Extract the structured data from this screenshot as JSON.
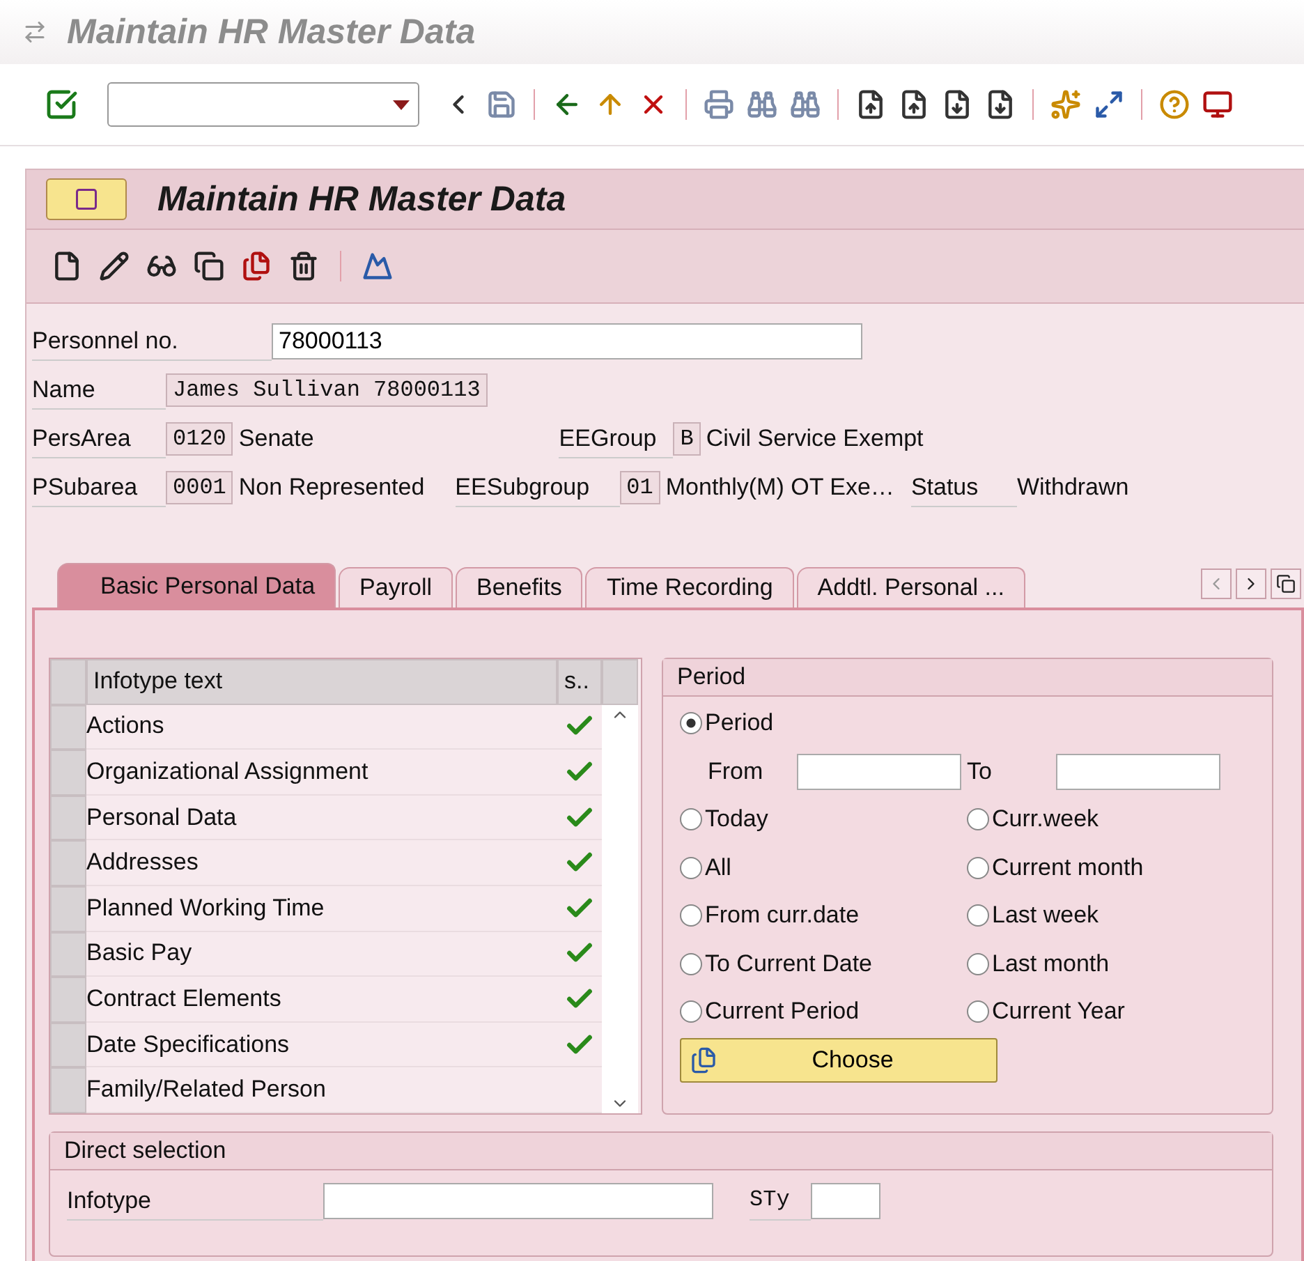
{
  "window": {
    "title": "Maintain HR Master Data"
  },
  "screen_title": "Maintain HR Master Data",
  "personnel_no": {
    "label": "Personnel no.",
    "value": "78000113"
  },
  "name": {
    "label": "Name",
    "value": "James Sullivan 78000113"
  },
  "pers_area": {
    "label": "PersArea",
    "code": "0120",
    "text": "Senate"
  },
  "ee_group": {
    "label": "EEGroup",
    "code": "B",
    "text": "Civil Service Exempt"
  },
  "p_subarea": {
    "label": "PSubarea",
    "code": "0001",
    "text": "Non Represented"
  },
  "ee_subgroup": {
    "label": "EESubgroup",
    "code": "01",
    "text": "Monthly(M) OT Exe…"
  },
  "status": {
    "label": "Status",
    "text": "Withdrawn"
  },
  "tabs": [
    {
      "label": "Basic Personal Data",
      "selected": true
    },
    {
      "label": "Payroll",
      "selected": false
    },
    {
      "label": "Benefits",
      "selected": false
    },
    {
      "label": "Time Recording",
      "selected": false
    },
    {
      "label": "Addtl. Personal ...",
      "selected": false
    }
  ],
  "infotype_table": {
    "columns": [
      "Infotype text",
      "s.."
    ],
    "rows": [
      {
        "text": "Actions",
        "checked": true
      },
      {
        "text": "Organizational Assignment",
        "checked": true
      },
      {
        "text": "Personal Data",
        "checked": true
      },
      {
        "text": "Addresses",
        "checked": true
      },
      {
        "text": "Planned Working Time",
        "checked": true
      },
      {
        "text": "Basic Pay",
        "checked": true
      },
      {
        "text": "Contract Elements",
        "checked": true
      },
      {
        "text": "Date Specifications",
        "checked": true
      },
      {
        "text": "Family/Related Person",
        "checked": false
      }
    ]
  },
  "period": {
    "title": "Period",
    "from_label": "From",
    "to_label": "To",
    "choose_label": "Choose",
    "options": [
      {
        "label": "Period",
        "selected": true
      },
      {
        "label": "Today",
        "selected": false
      },
      {
        "label": "Curr.week",
        "selected": false
      },
      {
        "label": "All",
        "selected": false
      },
      {
        "label": "Current month",
        "selected": false
      },
      {
        "label": "From curr.date",
        "selected": false
      },
      {
        "label": "Last week",
        "selected": false
      },
      {
        "label": "To Current Date",
        "selected": false
      },
      {
        "label": "Last month",
        "selected": false
      },
      {
        "label": "Current Period",
        "selected": false
      },
      {
        "label": "Current Year",
        "selected": false
      }
    ]
  },
  "direct_selection": {
    "title": "Direct selection",
    "infotype_label": "Infotype",
    "subtype_label": "STy"
  }
}
